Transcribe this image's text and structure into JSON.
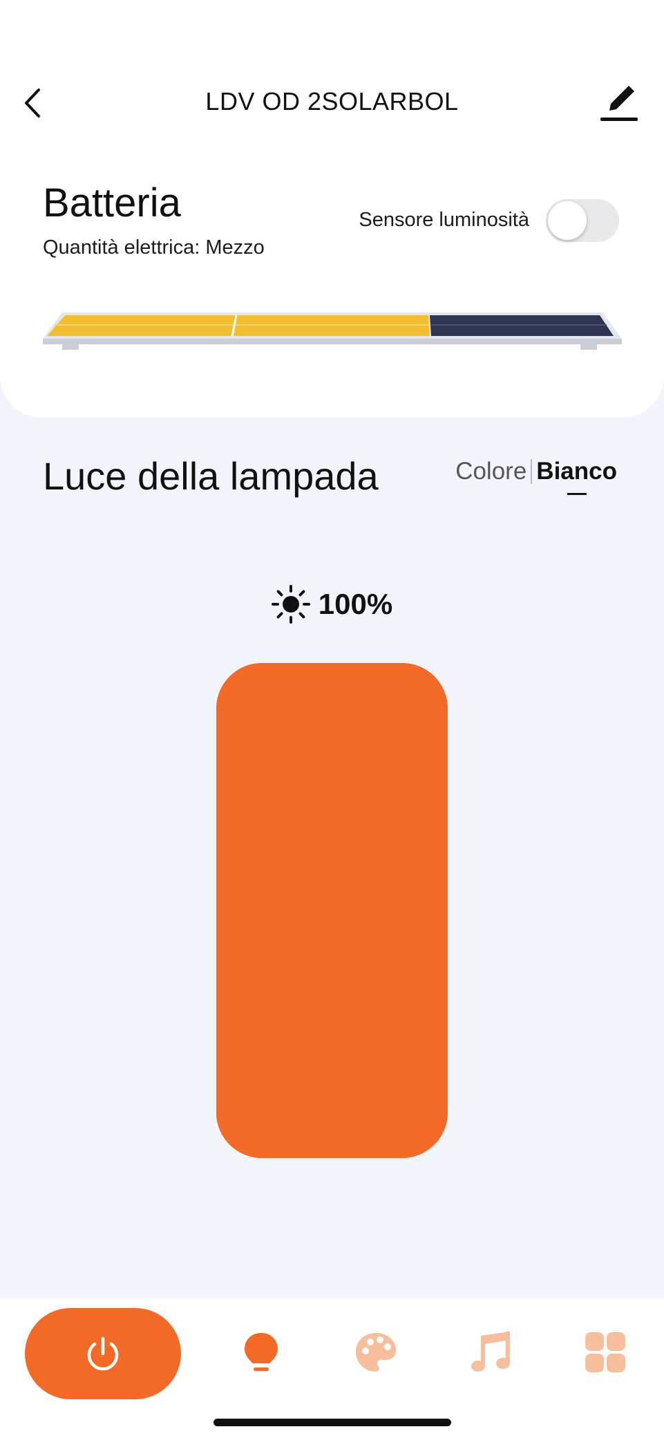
{
  "header": {
    "title": "LDV OD 2SOLARBOL",
    "back_icon": "chevron-left-icon",
    "edit_icon": "pencil-icon"
  },
  "battery": {
    "title": "Batteria",
    "quantity": "Quantità elettrica: Mezzo",
    "level": "Mezzo"
  },
  "sensor": {
    "label": "Sensore luminosità",
    "enabled": false
  },
  "lamp": {
    "title": "Luce della lampada",
    "tabs": [
      "Colore",
      "Bianco"
    ],
    "active_tab": "Bianco"
  },
  "brightness": {
    "value_text": "100%",
    "level_percent": 100,
    "icon": "sun-icon"
  },
  "colors": {
    "accent": "#f26a25",
    "accent_light": "#f7be9b",
    "background": "#f1f4fb",
    "panel_yellow": "#f2bd2f",
    "panel_dark": "#2e3550"
  },
  "nav": {
    "items": [
      {
        "name": "power",
        "icon": "power-icon",
        "active": true
      },
      {
        "name": "light",
        "icon": "bulb-icon",
        "active": true
      },
      {
        "name": "color",
        "icon": "palette-icon",
        "active": false
      },
      {
        "name": "music",
        "icon": "music-icon",
        "active": false
      },
      {
        "name": "scenes",
        "icon": "grid-icon",
        "active": false
      }
    ]
  }
}
